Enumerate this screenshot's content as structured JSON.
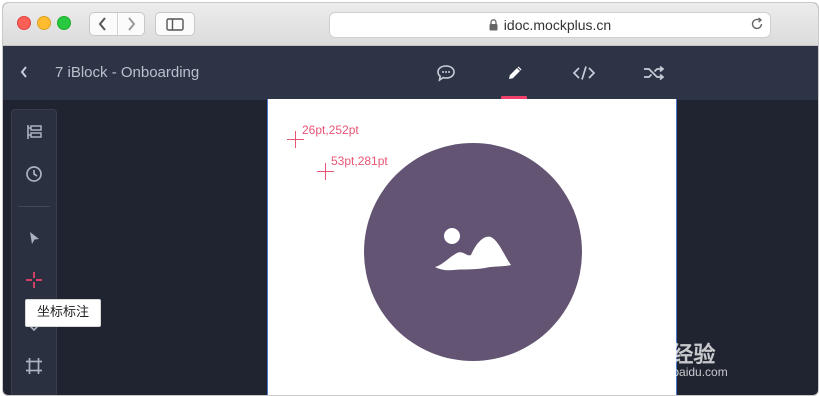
{
  "browser": {
    "url": "idoc.mockplus.cn",
    "colors": {
      "close": "#fe5f57",
      "minimize": "#febc2e",
      "zoom": "#28c840"
    }
  },
  "app": {
    "project_title": "7 iBlock - Onboarding",
    "tools": [
      "comment-icon",
      "pencil-icon",
      "code-icon",
      "shuffle-icon"
    ],
    "active_tool": "pencil-icon",
    "accent": "#f0416a"
  },
  "left_panel": {
    "icons": [
      "layers-icon",
      "history-icon",
      "pointer-icon",
      "crosshair-icon",
      "marker-icon",
      "artboard-icon"
    ],
    "tooltip": "坐标标注"
  },
  "canvas": {
    "markers": [
      {
        "label": "26pt,252pt"
      },
      {
        "label": "53pt,281pt"
      }
    ],
    "image_placeholder": "image-icon",
    "circle_color": "#625472"
  },
  "watermark": {
    "brand": "Bai 经验",
    "site": "jingyan.baidu.com"
  }
}
